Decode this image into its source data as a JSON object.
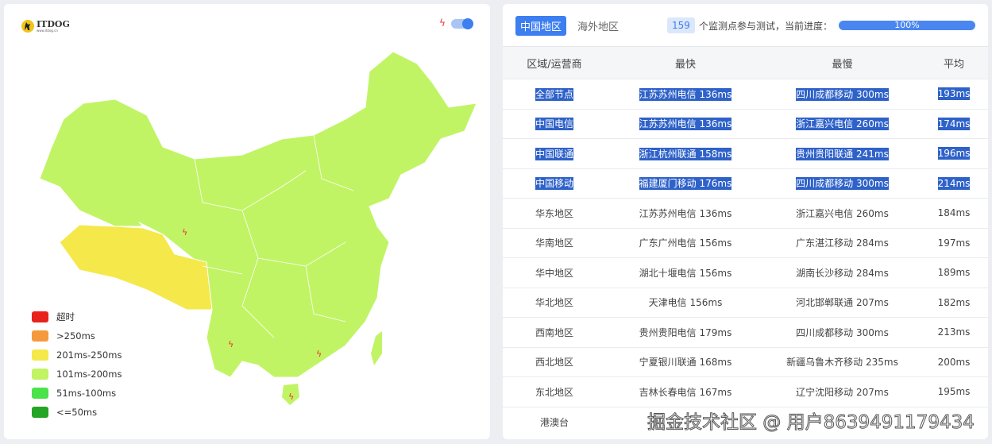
{
  "logo": {
    "name": "ITDOG",
    "url": "www.itdog.cn"
  },
  "map": {
    "toggle_on": true,
    "legend": [
      {
        "label": "超时",
        "color": "#e8231b"
      },
      {
        "label": ">250ms",
        "color": "#f59a3c"
      },
      {
        "label": "201ms-250ms",
        "color": "#f5e84a"
      },
      {
        "label": "101ms-200ms",
        "color": "#c1f465"
      },
      {
        "label": "51ms-100ms",
        "color": "#4be24a"
      },
      {
        "label": "<=50ms",
        "color": "#25a525"
      }
    ]
  },
  "header": {
    "tabs": [
      "中国地区",
      "海外地区"
    ],
    "active_tab": 0,
    "count": "159",
    "progress_text": "个监测点参与测试，当前进度：",
    "progress": "100%"
  },
  "table": {
    "columns": [
      "区域/运营商",
      "最快",
      "最慢",
      "平均"
    ],
    "rows": [
      {
        "region": "全部节点",
        "fast": "江苏苏州电信 136ms",
        "slow": "四川成都移动 300ms",
        "avg": "193ms",
        "selected": true
      },
      {
        "region": "中国电信",
        "fast": "江苏苏州电信 136ms",
        "slow": "浙江嘉兴电信 260ms",
        "avg": "174ms",
        "selected": true
      },
      {
        "region": "中国联通",
        "fast": "浙江杭州联通 158ms",
        "slow": "贵州贵阳联通 241ms",
        "avg": "196ms",
        "selected": true
      },
      {
        "region": "中国移动",
        "fast": "福建厦门移动 176ms",
        "slow": "四川成都移动 300ms",
        "avg": "214ms",
        "selected": true
      },
      {
        "region": "华东地区",
        "fast": "江苏苏州电信 136ms",
        "slow": "浙江嘉兴电信 260ms",
        "avg": "184ms"
      },
      {
        "region": "华南地区",
        "fast": "广东广州电信 156ms",
        "slow": "广东湛江移动 284ms",
        "avg": "197ms"
      },
      {
        "region": "华中地区",
        "fast": "湖北十堰电信 156ms",
        "slow": "湖南长沙移动 284ms",
        "avg": "189ms"
      },
      {
        "region": "华北地区",
        "fast": "天津电信 156ms",
        "slow": "河北邯郸联通 207ms",
        "avg": "182ms"
      },
      {
        "region": "西南地区",
        "fast": "贵州贵阳电信 179ms",
        "slow": "四川成都移动 300ms",
        "avg": "213ms"
      },
      {
        "region": "西北地区",
        "fast": "宁夏银川联通 168ms",
        "slow": "新疆乌鲁木齐移动 235ms",
        "avg": "200ms"
      },
      {
        "region": "东北地区",
        "fast": "吉林长春电信 167ms",
        "slow": "辽宁沈阳移动 207ms",
        "avg": "195ms"
      },
      {
        "region": "港澳台",
        "fast": "",
        "slow": "",
        "avg": ""
      }
    ]
  },
  "watermark": "掘金技术社区 @ 用户8639491179434"
}
